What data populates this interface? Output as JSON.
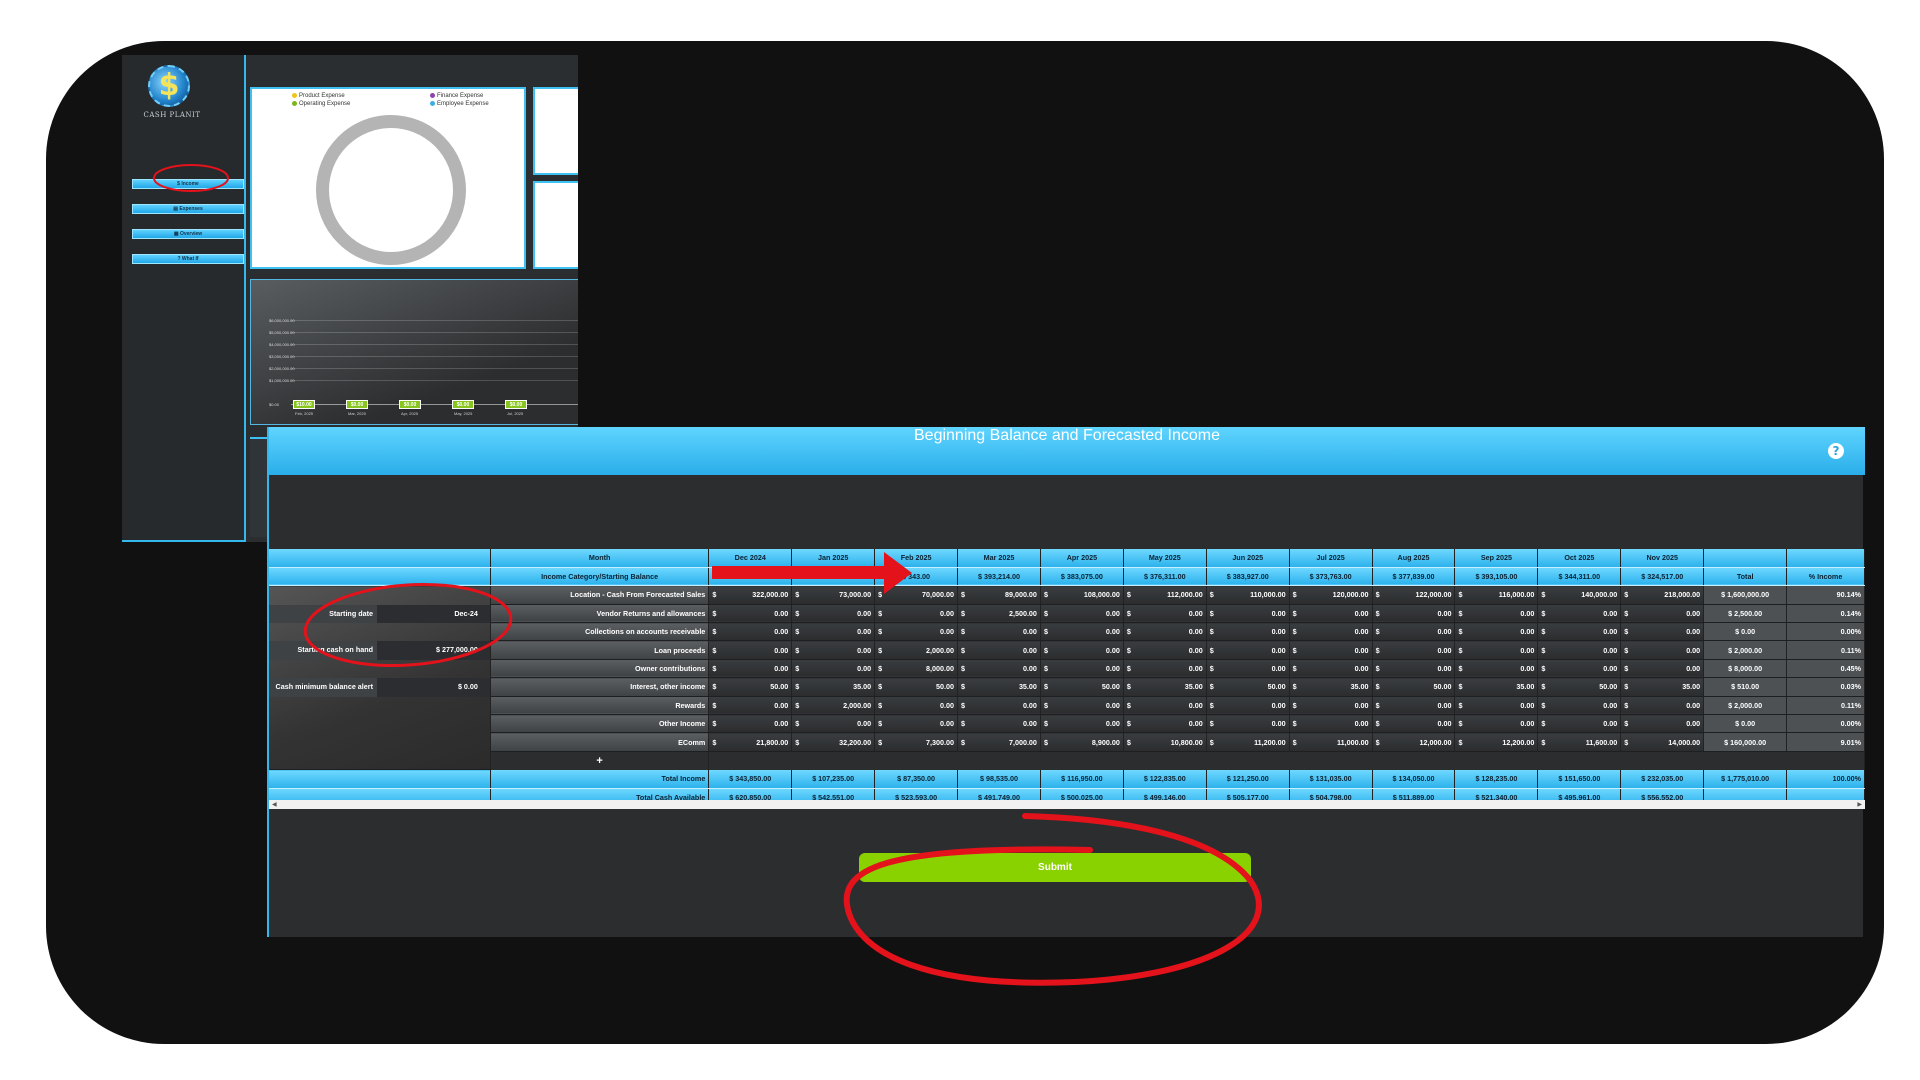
{
  "sidebar": {
    "app_name": "CASH PLANIT",
    "logo_glyph": "$",
    "items": [
      {
        "label": "Income",
        "icon": "dollar-icon"
      },
      {
        "label": "Expenses",
        "icon": "receipt-icon"
      },
      {
        "label": "Overview",
        "icon": "grid-icon"
      },
      {
        "label": "What If",
        "icon": "question-icon"
      }
    ]
  },
  "donut_legend": [
    "Product Expense",
    "Finance Expense",
    "Operating Expense",
    "Employee Expense"
  ],
  "legend_colors": [
    "#f0c419",
    "#8e44ad",
    "#7cb518",
    "#3ab0e0"
  ],
  "line_chart": {
    "y_labels": [
      "$6,000,000.00",
      "$5,000,000.00",
      "$4,000,000.00",
      "$3,000,000.00",
      "$2,000,000.00",
      "$1,000,000.00",
      "$0.00"
    ],
    "badges": [
      "$10.00",
      "$0.00",
      "$0.00",
      "$0.00",
      "$0.00"
    ],
    "x_labels": [
      "Feb, 2025",
      "Mar, 2025",
      "Apr, 2025",
      "May, 2025",
      "Jul, 2025"
    ]
  },
  "modal": {
    "title": "Beginning Balance and Forecasted Income",
    "help_glyph": "?",
    "header": {
      "month_label": "Month",
      "category_label": "Income Category/Starting Balance",
      "months": [
        "Dec 2024",
        "Jan 2025",
        "Feb 2025",
        "Mar 2025",
        "Apr 2025",
        "May 2025",
        "Jun 2025",
        "Jul 2025",
        "Aug 2025",
        "Sep 2025",
        "Oct 2025",
        "Nov 2025"
      ],
      "starting_balances": [
        "",
        "",
        "$ 343.00",
        "$ 393,214.00",
        "$ 383,075.00",
        "$ 376,311.00",
        "$ 383,927.00",
        "$ 373,763.00",
        "$ 377,839.00",
        "$ 393,105.00",
        "$ 344,311.00",
        "$ 324,517.00"
      ],
      "total_label": "Total",
      "pct_label": "% Income"
    },
    "settings": [
      {
        "label": "Starting date",
        "value": "Dec-24"
      },
      {
        "label": "Starting cash on hand",
        "value": "$ 277,000.00"
      },
      {
        "label": "Cash minimum balance alert",
        "value": "$ 0.00"
      }
    ],
    "rows": [
      {
        "label": "Location  - Cash From Forecasted Sales",
        "values": [
          "322,000.00",
          "73,000.00",
          "70,000.00",
          "89,000.00",
          "108,000.00",
          "112,000.00",
          "110,000.00",
          "120,000.00",
          "122,000.00",
          "116,000.00",
          "140,000.00",
          "218,000.00"
        ],
        "total": "$ 1,600,000.00",
        "pct": "90.14%"
      },
      {
        "label": "Vendor Returns and allowances",
        "values": [
          "0.00",
          "0.00",
          "0.00",
          "2,500.00",
          "0.00",
          "0.00",
          "0.00",
          "0.00",
          "0.00",
          "0.00",
          "0.00",
          "0.00"
        ],
        "total": "$ 2,500.00",
        "pct": "0.14%"
      },
      {
        "label": "Collections on accounts receivable",
        "values": [
          "0.00",
          "0.00",
          "0.00",
          "0.00",
          "0.00",
          "0.00",
          "0.00",
          "0.00",
          "0.00",
          "0.00",
          "0.00",
          "0.00"
        ],
        "total": "$ 0.00",
        "pct": "0.00%"
      },
      {
        "label": "Loan proceeds",
        "values": [
          "0.00",
          "0.00",
          "2,000.00",
          "0.00",
          "0.00",
          "0.00",
          "0.00",
          "0.00",
          "0.00",
          "0.00",
          "0.00",
          "0.00"
        ],
        "total": "$ 2,000.00",
        "pct": "0.11%"
      },
      {
        "label": "Owner contributions",
        "values": [
          "0.00",
          "0.00",
          "8,000.00",
          "0.00",
          "0.00",
          "0.00",
          "0.00",
          "0.00",
          "0.00",
          "0.00",
          "0.00",
          "0.00"
        ],
        "total": "$ 8,000.00",
        "pct": "0.45%"
      },
      {
        "label": "Interest, other income",
        "values": [
          "50.00",
          "35.00",
          "50.00",
          "35.00",
          "50.00",
          "35.00",
          "50.00",
          "35.00",
          "50.00",
          "35.00",
          "50.00",
          "35.00"
        ],
        "total": "$ 510.00",
        "pct": "0.03%"
      },
      {
        "label": "Rewards",
        "values": [
          "0.00",
          "2,000.00",
          "0.00",
          "0.00",
          "0.00",
          "0.00",
          "0.00",
          "0.00",
          "0.00",
          "0.00",
          "0.00",
          "0.00"
        ],
        "total": "$ 2,000.00",
        "pct": "0.11%"
      },
      {
        "label": "Other Income",
        "values": [
          "0.00",
          "0.00",
          "0.00",
          "0.00",
          "0.00",
          "0.00",
          "0.00",
          "0.00",
          "0.00",
          "0.00",
          "0.00",
          "0.00"
        ],
        "total": "$ 0.00",
        "pct": "0.00%"
      },
      {
        "label": "EComm",
        "values": [
          "21,800.00",
          "32,200.00",
          "7,300.00",
          "7,000.00",
          "8,900.00",
          "10,800.00",
          "11,200.00",
          "11,000.00",
          "12,000.00",
          "12,200.00",
          "11,600.00",
          "14,000.00"
        ],
        "total": "$ 160,000.00",
        "pct": "9.01%"
      }
    ],
    "currency_symbol": "$",
    "add_row_glyph": "+",
    "total_income": {
      "label": "Total Income",
      "values": [
        "$ 343,850.00",
        "$ 107,235.00",
        "$ 87,350.00",
        "$ 98,535.00",
        "$ 116,950.00",
        "$ 122,835.00",
        "$ 121,250.00",
        "$ 131,035.00",
        "$ 134,050.00",
        "$ 128,235.00",
        "$ 151,650.00",
        "$ 232,035.00"
      ],
      "total": "$ 1,775,010.00",
      "pct": "100.00%"
    },
    "total_cash": {
      "label": "Total Cash Available",
      "values": [
        "$ 620,850.00",
        "$ 542,551.00",
        "$ 523,593.00",
        "$ 491,749.00",
        "$ 500,025.00",
        "$ 499,146.00",
        "$ 505,177.00",
        "$ 504,798.00",
        "$ 511,889.00",
        "$ 521,340.00",
        "$ 495,961.00",
        "$ 556,552.00"
      ]
    },
    "submit_label": "Submit"
  },
  "colors": {
    "accent": "#2cb2ec",
    "submit": "#8ad100",
    "annotation": "#e3121b"
  }
}
